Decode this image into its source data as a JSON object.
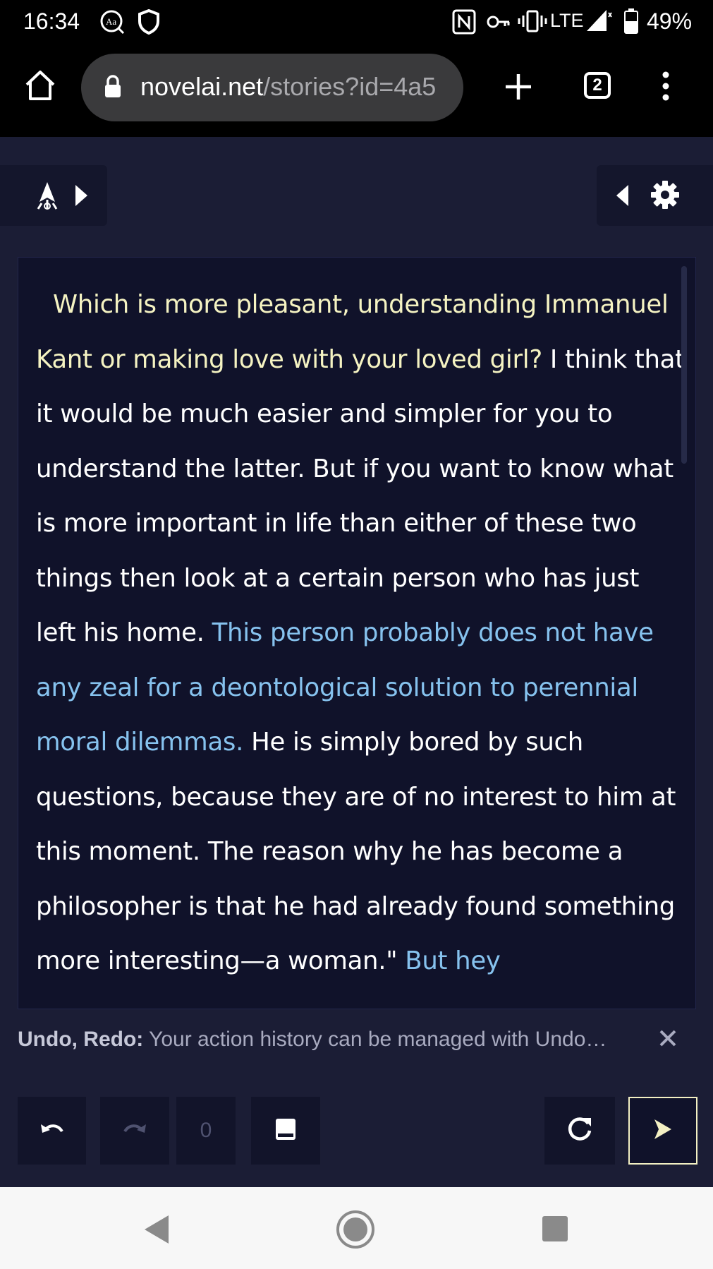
{
  "status_bar": {
    "time": "16:34",
    "network": "LTE",
    "battery": "49%",
    "icons": [
      "font-icon",
      "shield-icon",
      "nfc-icon",
      "vpn-key-icon",
      "vibrate-icon",
      "signal-icon",
      "battery-icon"
    ]
  },
  "browser": {
    "url_host": "novelai.net",
    "url_path": "/stories?id=4a5",
    "tab_count": "2"
  },
  "story": {
    "prompt": "Which is more pleasant, understanding Immanuel Kant or making love with your loved girl?",
    "ai_text_1": " I think that it would be much easier and simpler for you to understand the latter. But if you want to know what is more important in life than either of these two things then look at a certain person who has just left his home. ",
    "edited_text_1": "This person probably does not have any zeal for a deontological solution to perennial moral dilemmas.",
    "ai_text_2": " He is simply bored by such questions, because they are of no interest to him at this moment. The reason why he has become a philosopher is that he had already found something more interesting—a woman.\" ",
    "edited_text_2": "But hey"
  },
  "notice": {
    "title": "Undo, Redo:",
    "message": " Your action history can be managed with Undo…"
  },
  "toolbar": {
    "history_count": "0"
  },
  "colors": {
    "background": "#1b1d35",
    "editor_bg": "#10122a",
    "prompt_text": "#f5f3c2",
    "edited_text": "#86c2ee",
    "send_border": "#f3f0c3"
  }
}
